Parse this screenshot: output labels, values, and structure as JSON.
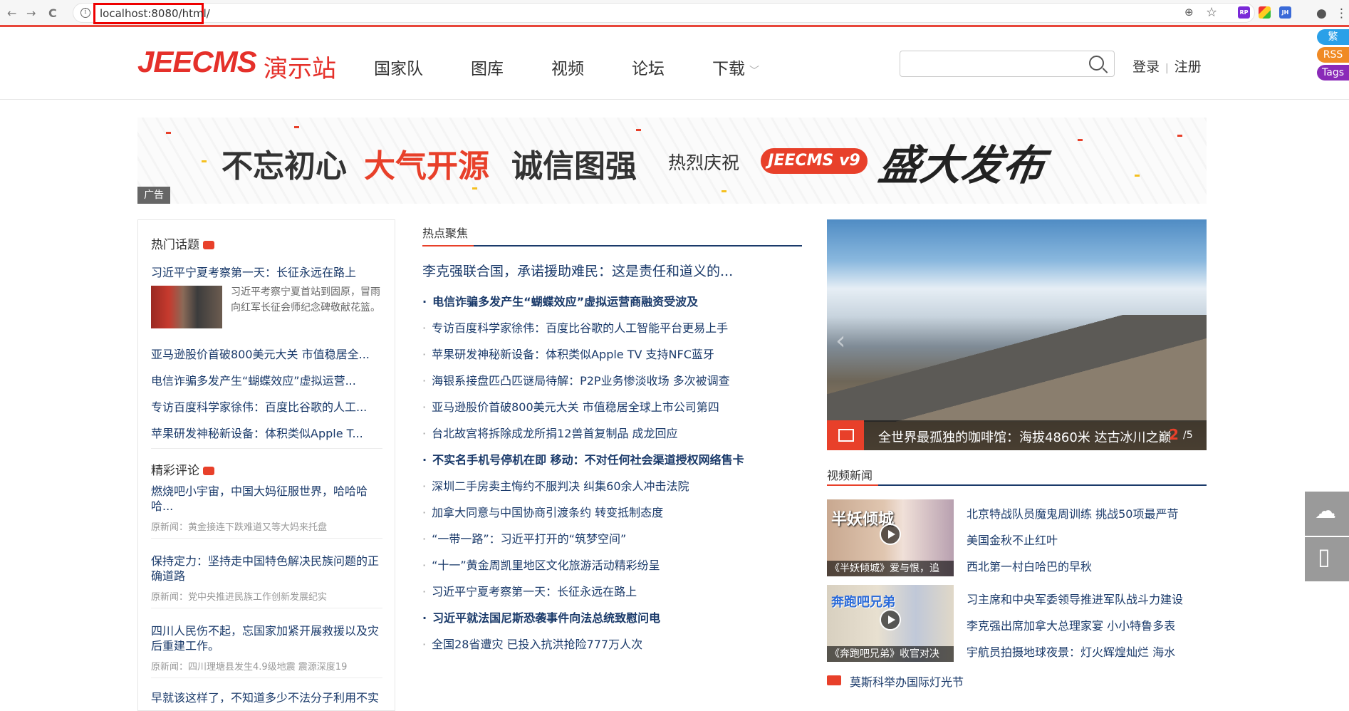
{
  "browser": {
    "url": "localhost:8080/html/",
    "info_glyph": "i",
    "back_glyph": "←",
    "forward_glyph": "→",
    "reload_glyph": "C",
    "zoom_glyph": "⊕",
    "star_glyph": "☆",
    "profile_glyph": "●",
    "menu_glyph": "⋮",
    "ext_icons": [
      "RP",
      "",
      "JH"
    ]
  },
  "header": {
    "logo_en": "JEECMS",
    "logo_cn": "演示站",
    "menu": [
      "国家队",
      "图库",
      "视频",
      "论坛",
      "下载"
    ],
    "menu_chevron": "﹀",
    "search_placeholder": "",
    "login": "登录",
    "auth_sep": "|",
    "register": "注册",
    "badges": [
      {
        "label": "繁",
        "color": "#2aa0e8"
      },
      {
        "label": "RSS",
        "color": "#f08a24"
      },
      {
        "label": "Tags",
        "color": "#8a2ab8"
      }
    ]
  },
  "banner": {
    "t1": "不忘初心",
    "t2": "大气开源",
    "t3": "诚信图强",
    "t4": "热烈庆祝",
    "v9": "JEECMS v9",
    "t5": "盛大发布",
    "ad_tag": "广告"
  },
  "left": {
    "hot_title": "热门话题",
    "hot_items": [
      "习近平宁夏考察第一天：长征永远在路上",
      "亚马逊股价首破800美元大关 市值稳居全...",
      "电信诈骗多发产生“蝴蝶效应”虚拟运营...",
      "专访百度科学家徐伟：百度比谷歌的人工...",
      "苹果研发神秘新设备：体积类似Apple T..."
    ],
    "hot_summary": "习近平考察宁夏首站到固原，冒雨向红军长征会师纪念碑敬献花篮。",
    "comments_title": "精彩评论",
    "comments": [
      {
        "title": "燃烧吧小宇宙，中国大妈征服世界，哈哈哈哈...",
        "source": "原新闻：黄金接连下跌难道又等大妈来托盘"
      },
      {
        "title": "保持定力：坚持走中国特色解决民族问题的正确道路",
        "source": "原新闻：党中央推进民族工作创新发展纪实"
      },
      {
        "title": "四川人民伤不起，忘国家加紧开展救援以及灾后重建工作。",
        "source": "原新闻：四川理塘县发生4.9级地震 震源深度19"
      },
      {
        "title": "早就该这样了，不知道多少不法分子利用不实",
        "source": ""
      }
    ]
  },
  "middle": {
    "title": "热点聚焦",
    "top": "李克强联合国，承诺援助难民：这是责任和道义的...",
    "items": [
      {
        "text": "电信诈骗多发产生“蝴蝶效应”虚拟运营商融资受波及",
        "bold": true
      },
      {
        "text": "专访百度科学家徐伟：百度比谷歌的人工智能平台更易上手",
        "bold": false
      },
      {
        "text": "苹果研发神秘新设备：体积类似Apple TV 支持NFC蓝牙",
        "bold": false
      },
      {
        "text": "海银系接盘匹凸匹谜局待解：P2P业务惨淡收场 多次被调查",
        "bold": false
      },
      {
        "text": "亚马逊股价首破800美元大关 市值稳居全球上市公司第四",
        "bold": false
      },
      {
        "text": "台北故宫将拆除成龙所捐12兽首复制品 成龙回应",
        "bold": false
      },
      {
        "text": "不实名手机号停机在即 移动：不对任何社会渠道授权网络售卡",
        "bold": true
      },
      {
        "text": "深圳二手房卖主悔约不服判决 纠集60余人冲击法院",
        "bold": false
      },
      {
        "text": "加拿大同意与中国协商引渡条约 转变抵制态度",
        "bold": false
      },
      {
        "text": "“一带一路”：习近平打开的“筑梦空间”",
        "bold": false
      },
      {
        "text": "“十一”黄金周凯里地区文化旅游活动精彩纷呈",
        "bold": false
      },
      {
        "text": "习近平宁夏考察第一天：长征永远在路上",
        "bold": false
      },
      {
        "text": "习近平就法国尼斯恐袭事件向法总统致慰问电",
        "bold": true
      },
      {
        "text": "全国28省遭灾 已投入抗洪抢险777万人次",
        "bold": false
      }
    ]
  },
  "right": {
    "slide_caption": "全世界最孤独的咖啡馆：海拔4860米 达古冰川之巅",
    "slide_index": "2",
    "slide_total": "/5",
    "slide_prev": "‹",
    "video_title": "视频新闻",
    "videos": [
      {
        "caption": "《半妖倾城》爱与恨，追",
        "overlay": "半妖倾城"
      },
      {
        "caption": "《奔跑吧兄弟》收官对决",
        "overlay": "奔跑吧兄弟"
      }
    ],
    "video_links_1": [
      "北京特战队员魔鬼周训练 挑战50项最严苛",
      "美国金秋不止红叶",
      "西北第一村白哈巴的早秋"
    ],
    "video_links_2": [
      "习主席和中央军委领导推进军队战斗力建设",
      "李克强出席加拿大总理家宴 小小特鲁多表",
      "宇航员拍摄地球夜景：灯火辉煌灿烂 海水"
    ],
    "video_last": "莫斯科举办国际灯光节"
  },
  "side": {
    "wechat_glyph": "☁",
    "mobile_glyph": "▯"
  }
}
